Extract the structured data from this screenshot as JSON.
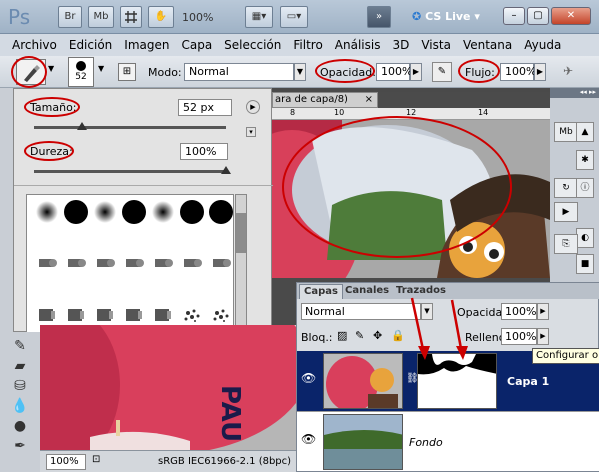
{
  "app": {
    "logo": "Ps",
    "br": "Br",
    "mb": "Mb",
    "zoom": "100%",
    "cs_live": "CS Live",
    "min": "–",
    "restore": "▢",
    "close": "✕"
  },
  "menu": [
    "Archivo",
    "Edición",
    "Imagen",
    "Capa",
    "Selección",
    "Filtro",
    "Análisis",
    "3D",
    "Vista",
    "Ventana",
    "Ayuda"
  ],
  "options": {
    "brush_size": "52",
    "mode_label": "Modo:",
    "mode_value": "Normal",
    "opacity_label": "Opacidad:",
    "opacity_value": "100%",
    "flow_label": "Flujo:",
    "flow_value": "100%"
  },
  "brush_panel": {
    "size_label": "Tamaño:",
    "size_value": "52 px",
    "hardness_label": "Dureza:",
    "hardness_value": "100%",
    "size_fraction": 0.25,
    "hardness_fraction": 1.0,
    "presets": [
      "",
      "",
      "",
      "",
      "",
      "",
      "",
      "",
      "",
      "",
      "",
      "",
      "",
      "",
      "",
      "",
      "",
      "",
      "",
      "",
      "14",
      "24",
      "27",
      "39",
      "46",
      "59",
      "11",
      "17"
    ]
  },
  "canvas": {
    "tab_title": "ara de capa/8)",
    "tab_close": "×",
    "ruler_marks": [
      "8",
      "10",
      "12",
      "14"
    ],
    "egg_text_left": "PAU",
    "egg_text_small": "ANILA"
  },
  "layers": {
    "tabs": [
      "Capas",
      "Canales",
      "Trazados"
    ],
    "blend_mode": "Normal",
    "opacity_label": "Opacidad:",
    "opacity_value": "100%",
    "lock_label": "Bloq.:",
    "fill_label": "Relleno:",
    "fill_value": "100%",
    "items": [
      {
        "name": "Capa 1"
      },
      {
        "name": "Fondo"
      }
    ]
  },
  "tooltip": "Configurar op",
  "status": {
    "zoom": "100%",
    "profile": "sRGB IEC61966-2.1 (8bpc)"
  },
  "colors": {
    "accent_red": "#cc0000",
    "selection_blue": "#0a246a"
  }
}
